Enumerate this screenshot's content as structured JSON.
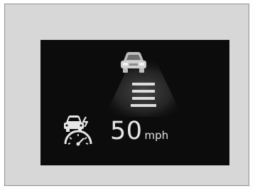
{
  "display": {
    "speed_value": "50",
    "speed_unit": "mph",
    "icons": {
      "lead_vehicle": "car-icon",
      "lane_gap": "gap-bars-icon",
      "adaptive_cruise": "acc-speedometer-icon"
    },
    "colors": {
      "frame_background": "#d7d7d7",
      "screen_background": "#0c0c0c",
      "text": "#e6e6e6",
      "indicator": "#dcdcdc",
      "lane_glow": "#3a3a3a"
    }
  }
}
